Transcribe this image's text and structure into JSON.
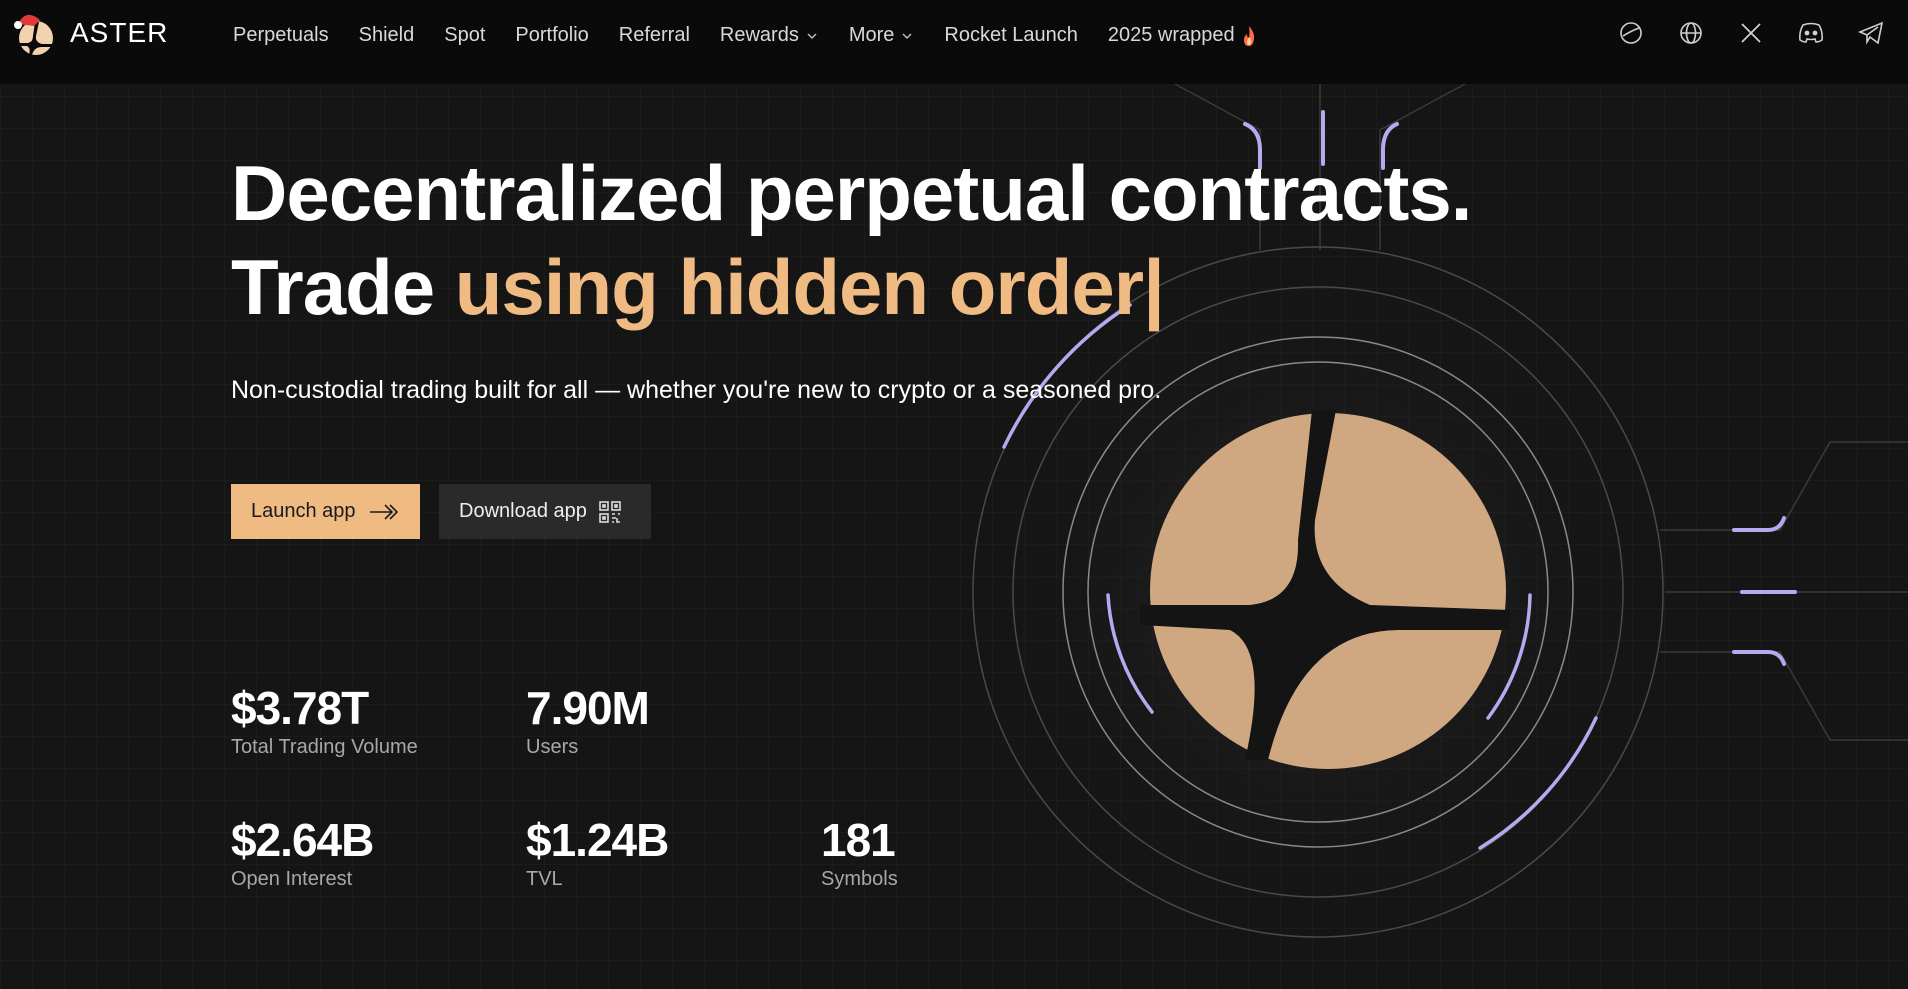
{
  "brand": {
    "name": "ASTER"
  },
  "nav": {
    "links": [
      {
        "label": "Perpetuals"
      },
      {
        "label": "Shield"
      },
      {
        "label": "Spot"
      },
      {
        "label": "Portfolio"
      },
      {
        "label": "Referral"
      },
      {
        "label": "Rewards"
      },
      {
        "label": "More"
      },
      {
        "label": "Rocket Launch"
      },
      {
        "label": "2025 wrapped"
      }
    ],
    "icons": [
      "theme-icon",
      "globe-icon",
      "x-icon",
      "discord-icon",
      "telegram-icon"
    ]
  },
  "hero": {
    "line1": "Decentralized perpetual contracts.",
    "line2_plain": "Trade ",
    "line2_accent": "using hidden order|",
    "subtitle": "Non-custodial trading built for all — whether you're new to crypto or a seasoned pro.",
    "launch_label": "Launch app",
    "download_label": "Download app"
  },
  "stats": {
    "volume": {
      "value": "$3.78T",
      "label": "Total Trading Volume"
    },
    "users": {
      "value": "7.90M",
      "label": "Users"
    },
    "open_interest": {
      "value": "$2.64B",
      "label": "Open Interest"
    },
    "tvl": {
      "value": "$1.24B",
      "label": "TVL"
    },
    "symbols": {
      "value": "181",
      "label": "Symbols"
    }
  },
  "colors": {
    "accent": "#efbb83",
    "background": "#141414",
    "nav_background": "#0a0a0a",
    "glow": "#b9a7f0"
  }
}
